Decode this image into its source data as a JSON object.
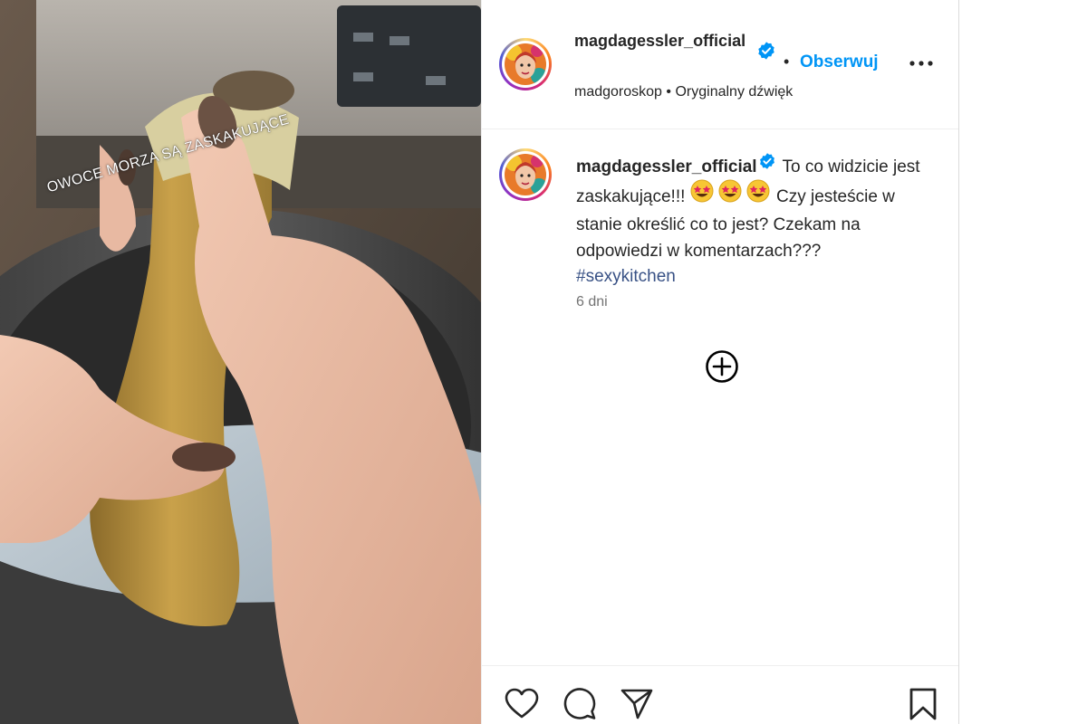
{
  "media": {
    "overlay_text": "OWOCE MORZA SĄ ZASKAKUJĄCE"
  },
  "header": {
    "username": "magdagessler_official",
    "separator": "•",
    "follow_label": "Obserwuj",
    "audio_author": "madgoroskop",
    "audio_separator": "•",
    "audio_label": "Oryginalny dźwięk"
  },
  "caption": {
    "username": "magdagessler_official",
    "text_part1": "To co widzicie jest zaskakujące!!!",
    "emojis": "🤩🤩🤩",
    "text_part2": "Czy jesteście w stanie określić co to jest? Czekam na odpowiedzi w komentarzach???",
    "hashtag": "#sexykitchen",
    "time": "6 dni"
  },
  "icons": {
    "verified": "verified-badge-icon",
    "more": "more-options-icon",
    "add_comment": "add-circle-icon",
    "like": "heart-icon",
    "comment": "comment-icon",
    "share": "send-icon",
    "save": "bookmark-icon"
  },
  "colors": {
    "accent": "#0095f6",
    "hashtag": "#385185",
    "muted": "#737373",
    "text": "#262626"
  }
}
